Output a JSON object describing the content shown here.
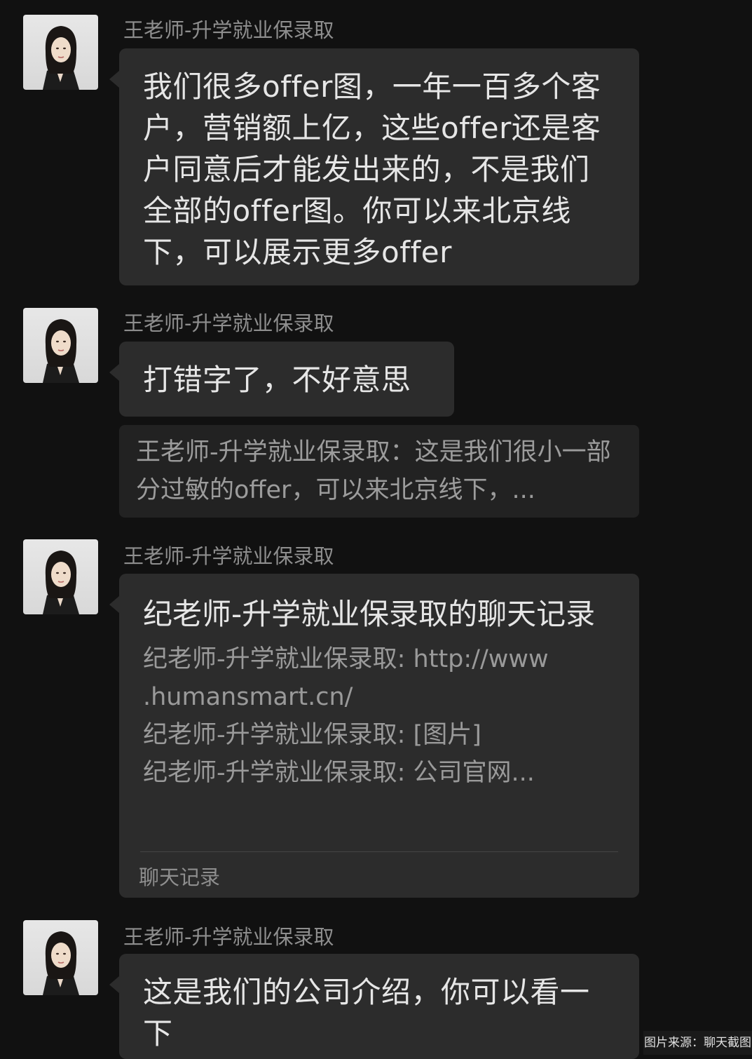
{
  "sender_name": "王老师-升学就业保录取",
  "messages": [
    {
      "sender": "王老师-升学就业保录取",
      "text": "我们很多offer图，一年一百多个客户，营销额上亿，这些offer还是客户同意后才能发出来的，不是我们全部的offer图。你可以来北京线下，可以展示更多offer"
    },
    {
      "sender": "王老师-升学就业保录取",
      "text": "打错字了，不好意思",
      "quote": "王老师-升学就业保录取：这是我们很小一部分过敏的offer，可以来北京线下，..."
    },
    {
      "sender": "王老师-升学就业保录取",
      "card": {
        "title": "纪老师-升学就业保录取的聊天记录",
        "lines": [
          "纪老师-升学就业保录取: http://www",
          ".humansmart.cn/",
          "纪老师-升学就业保录取: [图片]",
          "纪老师-升学就业保录取: 公司官网..."
        ],
        "footer": "聊天记录"
      }
    },
    {
      "sender": "王老师-升学就业保录取",
      "text": "这是我们的公司介绍，你可以看一下"
    }
  ],
  "watermark": "图片来源：聊天截图",
  "icons": {
    "avatar": "avatar-woman-icon"
  }
}
